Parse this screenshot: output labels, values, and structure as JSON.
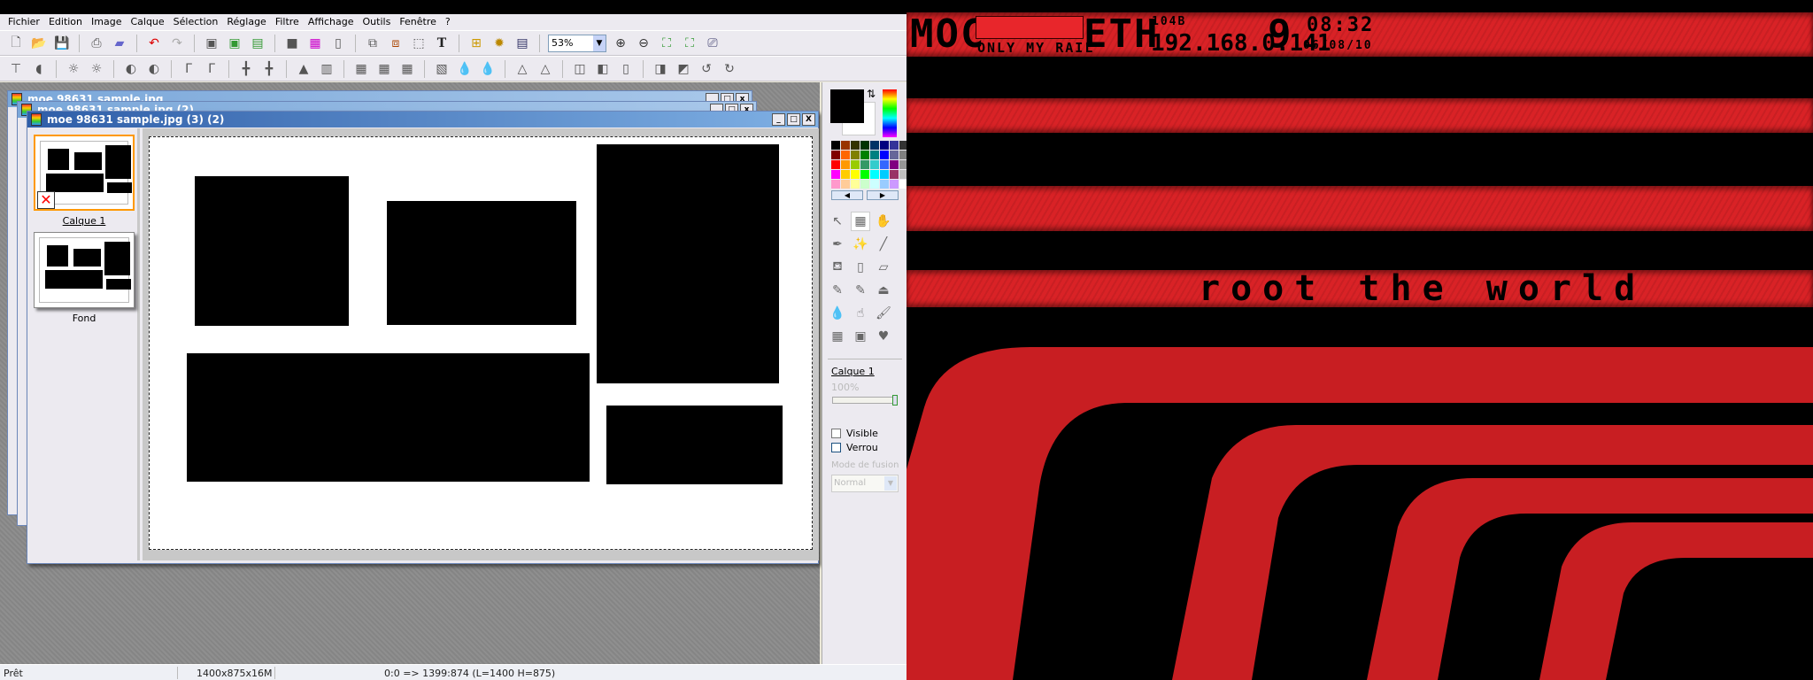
{
  "menu": [
    "Fichier",
    "Edition",
    "Image",
    "Calque",
    "Sélection",
    "Réglage",
    "Filtre",
    "Affichage",
    "Outils",
    "Fenêtre",
    "?"
  ],
  "toolbar": {
    "zoom": "53%",
    "text_tool": "T"
  },
  "windows": {
    "back1": "moe 98631 sample.jpg",
    "back2": "moe 98631 sample.jpg (2)",
    "front": "moe 98631 sample.jpg (3) (2)"
  },
  "layers": [
    {
      "name": "Calque 1"
    },
    {
      "name": "Fond"
    }
  ],
  "panel": {
    "layer_name": "Calque 1",
    "opacity": "100%",
    "opacity_value": 100,
    "visible_label": "Visible",
    "visible_checked": false,
    "lock_label": "Verrou",
    "lock_checked": false,
    "blend_label": "Mode de fusion",
    "blend_value": "Normal",
    "palette": [
      "#000000",
      "#993300",
      "#333300",
      "#003300",
      "#003366",
      "#000080",
      "#333399",
      "#333333",
      "#800000",
      "#ff6600",
      "#808000",
      "#008000",
      "#008080",
      "#0000ff",
      "#666699",
      "#808080",
      "#ff0000",
      "#ff9900",
      "#99cc00",
      "#339966",
      "#33cccc",
      "#3366ff",
      "#800080",
      "#969696",
      "#ff00ff",
      "#ffcc00",
      "#ffff00",
      "#00ff00",
      "#00ffff",
      "#00ccff",
      "#993366",
      "#c0c0c0",
      "#ff99cc",
      "#ffcc99",
      "#ffff99",
      "#ccffcc",
      "#ccffff",
      "#99ccff",
      "#cc99ff",
      "#ffffff"
    ]
  },
  "status": {
    "state": "Prêt",
    "size": "1400x875x16M",
    "coords": "0:0 => 1399:874 (L=1400  H=875)"
  },
  "wallpaper": {
    "logo": "MOC",
    "tagline": "ONLY MY RAIL",
    "iface": "ETH",
    "speed": "104B",
    "ip": "192.168.0.141",
    "nine": "9",
    "time": "08:32",
    "date": "06/08/10",
    "slogan": "root the world",
    "colors": {
      "red": "#d92226",
      "black": "#000000"
    }
  }
}
